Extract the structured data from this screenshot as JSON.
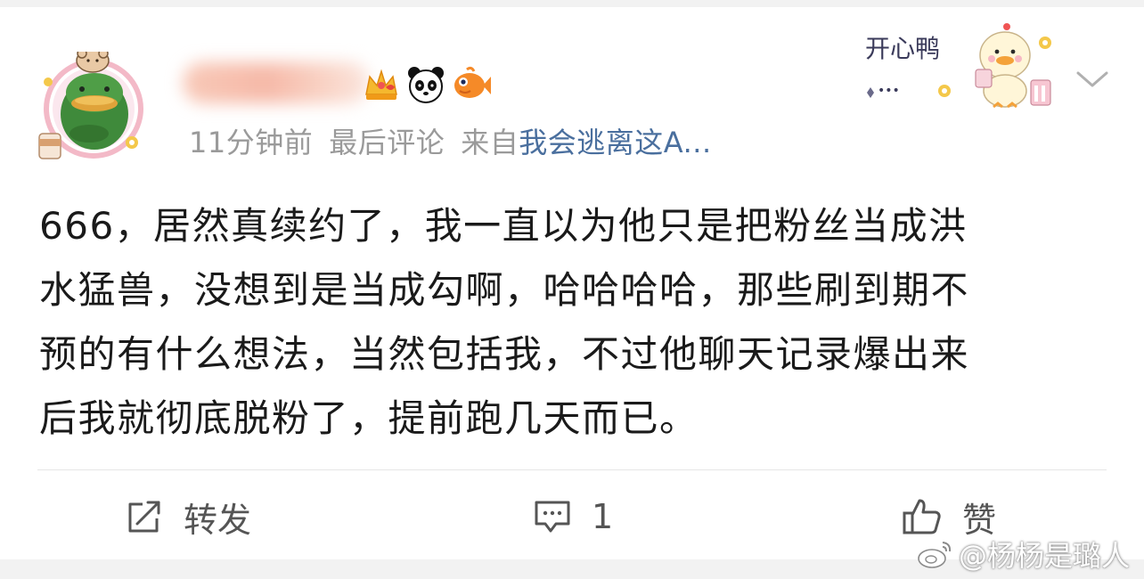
{
  "post": {
    "time": "11分钟前",
    "last_comment": "最后评论",
    "source_prefix": "来自",
    "source_name": "我会逃离这A...",
    "lines": [
      "666，居然真续约了，我一直以为他只是把粉丝当成洪",
      "水猛兽，没想到是当成勾啊，哈哈哈哈，那些刷到期不",
      "预的有什么想法，当然包括我，不过他聊天记录爆出来",
      "后我就彻底脱粉了，提前跑几天而已。"
    ]
  },
  "sticker": {
    "text": "开心鸭",
    "dots": "•••"
  },
  "actions": {
    "repost_label": "转发",
    "comment_count": "1",
    "like_label": "赞"
  },
  "watermark": {
    "text": "@杨杨是璐人"
  },
  "colors": {
    "meta_gray": "#9a9a9a",
    "source_link": "#4a6f9e",
    "body_text": "#1a1a1a",
    "avatar_ring": "#f3b9c7",
    "username_blur": "#f6b9a8"
  },
  "icons": {
    "avatar": "frog-duck-avatar",
    "badges": [
      "crown-icon",
      "panda-icon",
      "fish-icon"
    ],
    "chevron": "chevron-down-icon",
    "repost": "repost-icon",
    "comment": "comment-icon",
    "like": "thumbs-up-icon",
    "weibo": "weibo-logo-icon"
  }
}
